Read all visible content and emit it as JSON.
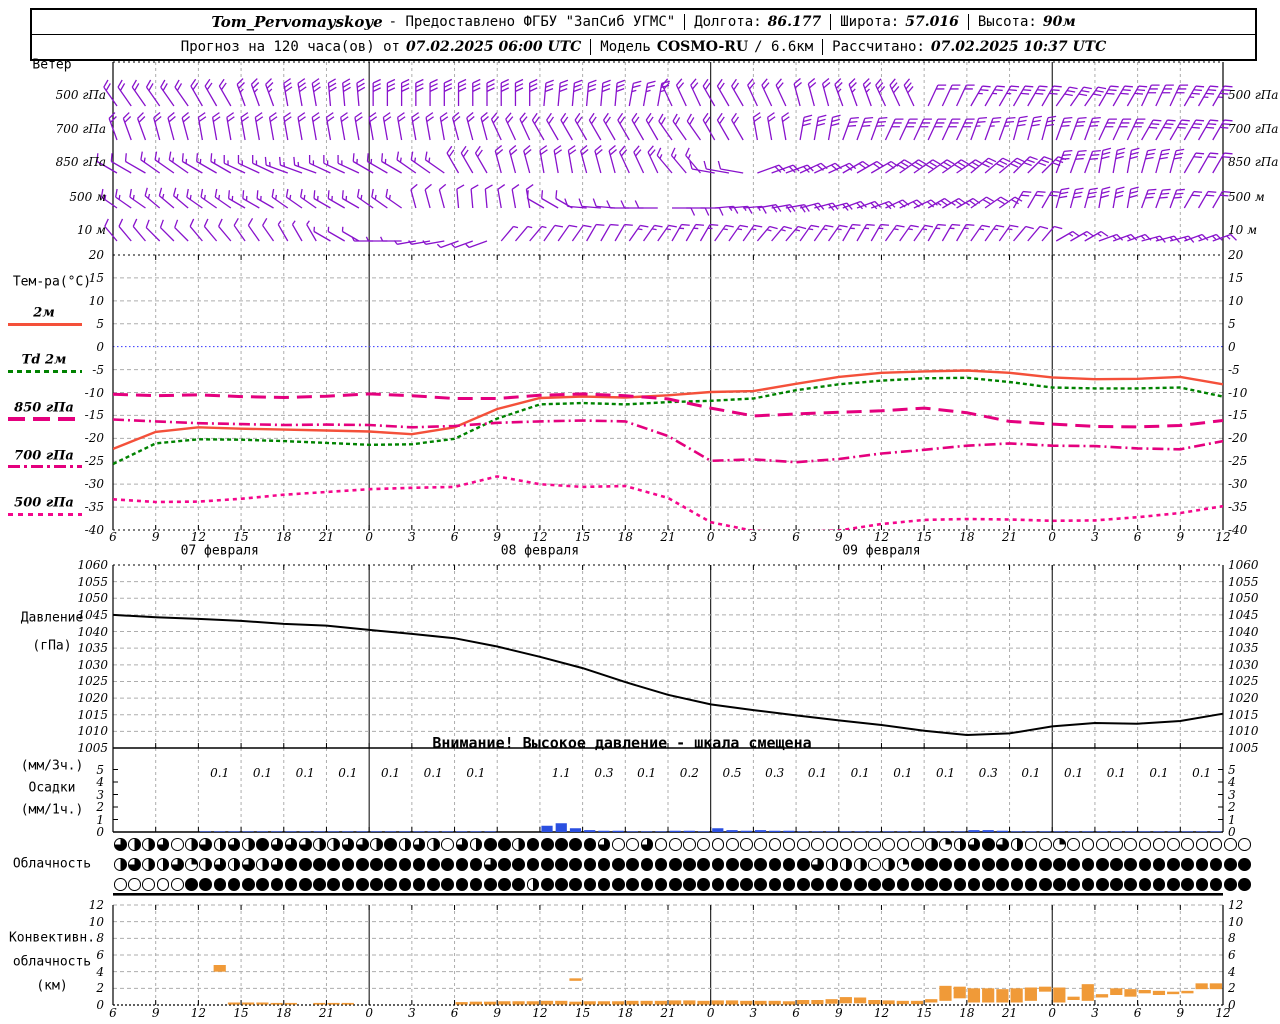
{
  "header": {
    "station": "Tom_Pervomayskoye",
    "provided": "- Предоставлено ФГБУ \"ЗапСиб УГМС\"",
    "lon_label": "Долгота:",
    "lon": "86.177",
    "lat_label": "Широта:",
    "lat": "57.016",
    "alt_label": "Высота:",
    "alt": "90м",
    "forecast": "Прогноз на 120 часа(ов) от",
    "run_time": "07.02.2025 06:00 UTC",
    "model_label": "Модель",
    "model": "COSMO-RU",
    "model_res": "/ 6.6км",
    "calc_label": "Рассчитано:",
    "calc_time": "07.02.2025 10:37 UTC"
  },
  "axis": {
    "hours": [
      "6",
      "9",
      "12",
      "15",
      "18",
      "21",
      "0",
      "3",
      "6",
      "9",
      "12",
      "15",
      "18",
      "21",
      "0",
      "3",
      "6",
      "9",
      "12",
      "15",
      "18",
      "21",
      "0",
      "3",
      "6",
      "9",
      "12"
    ],
    "dates": [
      {
        "label": "07 февраля",
        "tick": 2.5
      },
      {
        "label": "08 февраля",
        "tick": 10
      },
      {
        "label": "09 февраля",
        "tick": 18
      }
    ],
    "day_boundary_ticks": [
      6,
      14,
      22
    ]
  },
  "wind": {
    "title": "Ветер",
    "color": "#8812CC",
    "levels": [
      {
        "label": "500 гПа",
        "y": 95,
        "angles": [
          -35,
          -35,
          -30,
          -20,
          -10,
          -5,
          0,
          0,
          0,
          0,
          5,
          5,
          10,
          -25,
          -30,
          -25,
          -15,
          -20,
          -25,
          25,
          30,
          30,
          35,
          30,
          25,
          30,
          30
        ],
        "feathers": [
          2,
          2,
          2,
          2.5,
          3,
          3,
          3,
          3,
          3,
          3,
          3,
          3,
          2.5,
          2,
          2,
          2,
          2,
          2.5,
          3,
          2,
          2.5,
          3,
          3,
          3,
          3,
          3.5,
          3.5
        ]
      },
      {
        "label": "700 гПа",
        "y": 129,
        "angles": [
          -20,
          -15,
          -10,
          -10,
          -10,
          -10,
          -10,
          -10,
          -15,
          -25,
          -30,
          -30,
          -30,
          -35,
          -30,
          -10,
          10,
          20,
          25,
          25,
          20,
          15,
          20,
          25,
          30,
          30,
          30
        ],
        "feathers": [
          2,
          2,
          2,
          2,
          2,
          2,
          2,
          2,
          2,
          2,
          2,
          2,
          2,
          2,
          2,
          2,
          3,
          3,
          3,
          3,
          2.5,
          3,
          3,
          3,
          3,
          3,
          3
        ]
      },
      {
        "label": "850 гПа",
        "y": 162,
        "angles": [
          -60,
          -55,
          -60,
          -65,
          -70,
          -65,
          -60,
          -55,
          -30,
          -15,
          -10,
          -15,
          -25,
          -40,
          -80,
          70,
          65,
          60,
          55,
          55,
          50,
          45,
          20,
          10,
          15,
          30,
          35
        ],
        "feathers": [
          1,
          1.5,
          1.5,
          1.5,
          1.5,
          1.5,
          1.5,
          1.5,
          2,
          2,
          2,
          2,
          2,
          1.5,
          1,
          2,
          2,
          2,
          3,
          3,
          3,
          3,
          3,
          3,
          3,
          2,
          2
        ]
      },
      {
        "label": "500 м",
        "y": 197,
        "angles": [
          -55,
          -50,
          -55,
          -60,
          -55,
          -60,
          -55,
          -15,
          -5,
          -10,
          -60,
          -85,
          -90,
          90,
          85,
          80,
          75,
          70,
          65,
          60,
          55,
          30,
          15,
          10,
          20,
          30,
          35
        ],
        "feathers": [
          1.5,
          1.5,
          1.5,
          1.5,
          1.5,
          1.5,
          1.5,
          1,
          1,
          1,
          1,
          1,
          1,
          1,
          1.5,
          2,
          2,
          2,
          2,
          2.5,
          2,
          2,
          3,
          3,
          3,
          2,
          2
        ]
      },
      {
        "label": "10 м",
        "y": 230,
        "angles": [
          -40,
          -45,
          -40,
          -35,
          -30,
          -60,
          -90,
          -100,
          -110,
          40,
          35,
          30,
          35,
          30,
          35,
          40,
          35,
          30,
          35,
          30,
          35,
          40,
          60,
          70,
          75,
          70,
          65
        ],
        "feathers": [
          1,
          1,
          1,
          1,
          0.5,
          0.5,
          0.5,
          0.5,
          0.5,
          0.5,
          1,
          1,
          1.5,
          1.5,
          1.5,
          1.5,
          1.5,
          1.5,
          1.5,
          1.5,
          1.5,
          1,
          1.5,
          1.5,
          1.5,
          1.5,
          1.5
        ]
      }
    ]
  },
  "legend": {
    "title": "Тем-ра(°C)",
    "items": [
      {
        "label": "2м"
      },
      {
        "label": "Td 2м"
      },
      {
        "label": "850 гПа"
      },
      {
        "label": "700 гПа"
      },
      {
        "label": "500 гПа"
      }
    ]
  },
  "pressure_panel": {
    "title1": "Давление",
    "title2": "(гПа)",
    "warning": "Внимание! Высокое давление - шкала смещена"
  },
  "precip_panel": {
    "title1": "(мм/3ч.)",
    "title2": "Осадки",
    "title3": "(мм/1ч.)"
  },
  "clouds_panel": {
    "title": "Облачность"
  },
  "conv_panel": {
    "title1": "Конвективн.",
    "title2": "облачность",
    "title3": "(км)"
  },
  "colors": {
    "barb": "#8812CC",
    "t2m": "#F4503A",
    "td2m": "#008200",
    "magenta": "#E4007E",
    "pink500": "#F4078C",
    "zero_line": "#3333FF",
    "precip_bar": "#2A4FE0",
    "conv_bar": "#F09A38",
    "grid": "#ADADAD",
    "axis": "#000000"
  },
  "chart_data": [
    {
      "id": "temperature",
      "type": "line",
      "ylabel": "Тем-ра(°C)",
      "ylim": [
        -40,
        20
      ],
      "yticks": [
        20,
        15,
        10,
        5,
        0,
        -5,
        -10,
        -15,
        -20,
        -25,
        -30,
        -35,
        -40
      ],
      "x_start": "07.02.2025 06:00",
      "x_step_hours": 3,
      "series": [
        {
          "name": "2м",
          "color": "#F4503A",
          "dash": "solid",
          "width": 2.4,
          "values": [
            -22.3,
            -18.6,
            -17.6,
            -17.9,
            -18.1,
            -18.3,
            -18.5,
            -19.1,
            -17.6,
            -13.6,
            -11.2,
            -10.9,
            -11.1,
            -10.6,
            -9.9,
            -9.7,
            -8.1,
            -6.6,
            -5.7,
            -5.4,
            -5.2,
            -5.7,
            -6.7,
            -7.1,
            -7.0,
            -6.6,
            -8.2
          ]
        },
        {
          "name": "Td 2м",
          "color": "#008200",
          "dash": "4 3",
          "width": 2.4,
          "values": [
            -25.6,
            -21.1,
            -20.2,
            -20.3,
            -20.6,
            -21.0,
            -21.4,
            -21.3,
            -20.1,
            -15.7,
            -12.6,
            -12.3,
            -12.6,
            -12.1,
            -11.8,
            -11.3,
            -9.5,
            -8.2,
            -7.4,
            -6.9,
            -6.8,
            -7.7,
            -8.9,
            -9.1,
            -9.1,
            -8.9,
            -10.9
          ]
        },
        {
          "name": "850 гПа",
          "color": "#E4007E",
          "dash": "15 8",
          "width": 3,
          "values": [
            -10.4,
            -10.7,
            -10.5,
            -10.9,
            -11.1,
            -10.8,
            -10.3,
            -10.7,
            -11.3,
            -11.3,
            -10.6,
            -10.3,
            -10.7,
            -11.4,
            -13.4,
            -15.1,
            -14.7,
            -14.3,
            -14.0,
            -13.4,
            -14.4,
            -16.3,
            -16.9,
            -17.4,
            -17.5,
            -17.2,
            -16.1
          ]
        },
        {
          "name": "700 гПа",
          "color": "#E4007E",
          "dash": "11 4 2 4",
          "width": 2.6,
          "values": [
            -15.9,
            -16.3,
            -16.7,
            -16.9,
            -17.1,
            -17.0,
            -17.1,
            -17.6,
            -17.3,
            -16.6,
            -16.3,
            -16.1,
            -16.3,
            -19.5,
            -24.9,
            -24.6,
            -25.2,
            -24.5,
            -23.3,
            -22.5,
            -21.6,
            -21.1,
            -21.6,
            -21.7,
            -22.2,
            -22.4,
            -20.6
          ]
        },
        {
          "name": "500 гПа",
          "color": "#F4078C",
          "dash": "4 4",
          "width": 2.6,
          "values": [
            -33.3,
            -33.9,
            -33.8,
            -33.2,
            -32.3,
            -31.7,
            -31.1,
            -30.8,
            -30.6,
            -28.3,
            -30.0,
            -30.6,
            -30.4,
            -33.0,
            -38.3,
            -40.2,
            -40.4,
            -40.1,
            -38.7,
            -37.8,
            -37.6,
            -37.7,
            -38.0,
            -37.9,
            -37.2,
            -36.3,
            -34.8
          ]
        }
      ]
    },
    {
      "id": "pressure",
      "type": "line",
      "ylabel": "Давление (гПа)",
      "ylim": [
        1005,
        1060
      ],
      "yticks": [
        1060,
        1055,
        1050,
        1045,
        1040,
        1035,
        1030,
        1025,
        1020,
        1015,
        1010,
        1005
      ],
      "series": [
        {
          "name": "Давление",
          "color": "#000000",
          "width": 2,
          "values": [
            1045.0,
            1044.3,
            1043.8,
            1043.2,
            1042.3,
            1041.8,
            1040.5,
            1039.3,
            1038.0,
            1035.5,
            1032.4,
            1029.0,
            1024.8,
            1021.0,
            1018.1,
            1016.4,
            1014.8,
            1013.3,
            1011.9,
            1010.2,
            1008.9,
            1009.4,
            1011.5,
            1012.5,
            1012.3,
            1013.1,
            1015.3
          ]
        }
      ]
    },
    {
      "id": "precipitation",
      "type": "bar",
      "ylabel": "Осадки (мм/3ч.) (мм/1ч.)",
      "ylim": [
        0,
        5.5
      ],
      "yticks": [
        5,
        4,
        3,
        2,
        1,
        0
      ],
      "bar_color": "#2A4FE0",
      "amounts_3h": [
        "",
        "",
        "0.1",
        "0.1",
        "0.1",
        "0.1",
        "0.1",
        "0.1",
        "0.1",
        "",
        "1.1",
        "0.3",
        "0.1",
        "0.2",
        "0.5",
        "0.3",
        "0.1",
        "0.1",
        "0.1",
        "0.1",
        "0.3",
        "0.1",
        "0.1",
        "0.1",
        "0.1",
        "0.1"
      ],
      "hourly_bars": [
        0,
        0,
        0,
        0,
        0,
        0,
        0.05,
        0.05,
        0.05,
        0.05,
        0.05,
        0.05,
        0.05,
        0.05,
        0.05,
        0.05,
        0.05,
        0.05,
        0.05,
        0.05,
        0.05,
        0.05,
        0.05,
        0.05,
        0.05,
        0.05,
        0.05,
        0,
        0,
        0,
        0.5,
        0.7,
        0.3,
        0.15,
        0.1,
        0.1,
        0.05,
        0.05,
        0.05,
        0.1,
        0.1,
        0.05,
        0.3,
        0.15,
        0.1,
        0.15,
        0.1,
        0.1,
        0.05,
        0.05,
        0.05,
        0.05,
        0.05,
        0.05,
        0.05,
        0.05,
        0.05,
        0.05,
        0.05,
        0.05,
        0.15,
        0.15,
        0.1,
        0.05,
        0.05,
        0.05,
        0.05,
        0.05,
        0.05,
        0.05,
        0.05,
        0.05,
        0.05,
        0.05,
        0.05,
        0.05,
        0.05,
        0.05
      ]
    },
    {
      "id": "cloud_cover",
      "type": "table",
      "ylabel": "Облачность",
      "rows_octas_eighths": [
        "64460464648666446648464064884888886006000000000000000000042468640020000000000000",
        "46446246464688888888888888688888888888888888888886444042888888888888888888888888",
        "00000888888888888888888888888488888888888888888888888888888888888888888888888888"
      ]
    },
    {
      "id": "convective_clouds",
      "type": "bar",
      "ylabel": "Конвективн. облачность (км)",
      "ylim": [
        0,
        13
      ],
      "yticks": [
        12,
        10,
        8,
        6,
        4,
        2,
        0
      ],
      "bar_color": "#F09A38",
      "bars_h_base_top": [
        [
          7,
          4.0,
          4.8
        ],
        [
          8,
          0.05,
          0.3
        ],
        [
          9,
          0.05,
          0.3
        ],
        [
          10,
          0.05,
          0.3
        ],
        [
          11,
          0.05,
          0.25
        ],
        [
          12,
          0.05,
          0.25
        ],
        [
          14,
          0.05,
          0.25
        ],
        [
          15,
          0.05,
          0.25
        ],
        [
          16,
          0.05,
          0.25
        ],
        [
          24,
          0.05,
          0.35
        ],
        [
          25,
          0.05,
          0.4
        ],
        [
          26,
          0.05,
          0.4
        ],
        [
          27,
          0.05,
          0.45
        ],
        [
          28,
          0.05,
          0.45
        ],
        [
          29,
          0.05,
          0.45
        ],
        [
          30,
          0.05,
          0.5
        ],
        [
          31,
          0.05,
          0.5
        ],
        [
          32,
          2.9,
          3.2
        ],
        [
          32,
          0.05,
          0.4
        ],
        [
          33,
          0.05,
          0.45
        ],
        [
          34,
          0.05,
          0.45
        ],
        [
          35,
          0.05,
          0.45
        ],
        [
          36,
          0.05,
          0.5
        ],
        [
          37,
          0.05,
          0.5
        ],
        [
          38,
          0.05,
          0.5
        ],
        [
          39,
          0.05,
          0.55
        ],
        [
          40,
          0.05,
          0.55
        ],
        [
          41,
          0.05,
          0.5
        ],
        [
          42,
          0.05,
          0.55
        ],
        [
          43,
          0.05,
          0.55
        ],
        [
          44,
          0.05,
          0.5
        ],
        [
          45,
          0.05,
          0.5
        ],
        [
          46,
          0.05,
          0.5
        ],
        [
          47,
          0.05,
          0.45
        ],
        [
          48,
          0.1,
          0.6
        ],
        [
          49,
          0.1,
          0.6
        ],
        [
          50,
          0.15,
          0.7
        ],
        [
          51,
          0.2,
          0.95
        ],
        [
          52,
          0.2,
          0.9
        ],
        [
          53,
          0.1,
          0.6
        ],
        [
          54,
          0.1,
          0.55
        ],
        [
          55,
          0.1,
          0.5
        ],
        [
          56,
          0.1,
          0.5
        ],
        [
          57,
          0.3,
          0.7
        ],
        [
          58,
          0.5,
          2.3
        ],
        [
          59,
          0.8,
          2.2
        ],
        [
          60,
          0.3,
          2.0
        ],
        [
          61,
          0.3,
          2.0
        ],
        [
          62,
          0.3,
          1.9
        ],
        [
          63,
          0.3,
          2.0
        ],
        [
          64,
          0.5,
          2.1
        ],
        [
          65,
          1.6,
          2.2
        ],
        [
          66,
          0.3,
          2.1
        ],
        [
          67,
          0.6,
          1.0
        ],
        [
          68,
          0.5,
          2.5
        ],
        [
          69,
          0.9,
          1.3
        ],
        [
          70,
          1.2,
          2.0
        ],
        [
          71,
          1.0,
          1.9
        ],
        [
          72,
          1.4,
          1.8
        ],
        [
          73,
          1.2,
          1.7
        ],
        [
          74,
          1.3,
          1.6
        ],
        [
          75,
          1.4,
          1.7
        ],
        [
          76,
          1.9,
          2.6
        ],
        [
          77,
          1.9,
          2.6
        ]
      ]
    }
  ]
}
